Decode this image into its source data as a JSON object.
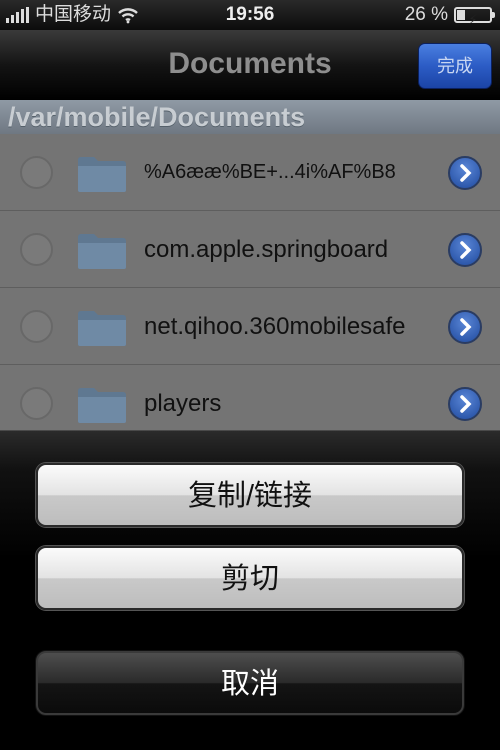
{
  "status_bar": {
    "carrier": "中国移动",
    "time": "19:56",
    "battery_percent": "26 %",
    "battery_level": 0.26
  },
  "nav": {
    "title": "Documents",
    "done_label": "完成"
  },
  "path": "/var/mobile/Documents",
  "files": [
    {
      "name": "%A6ææ%BE+...4i%AF%B8",
      "icon": "folder-icon"
    },
    {
      "name": "com.apple.springboard",
      "icon": "folder-icon"
    },
    {
      "name": "net.qihoo.360mobilesafe",
      "icon": "folder-icon"
    },
    {
      "name": "players",
      "icon": "folder-icon"
    }
  ],
  "action_sheet": {
    "copy_link_label": "复制/链接",
    "cut_label": "剪切",
    "cancel_label": "取消"
  },
  "colors": {
    "accent_blue": "#2c5cc5",
    "list_bg": "#747474"
  }
}
